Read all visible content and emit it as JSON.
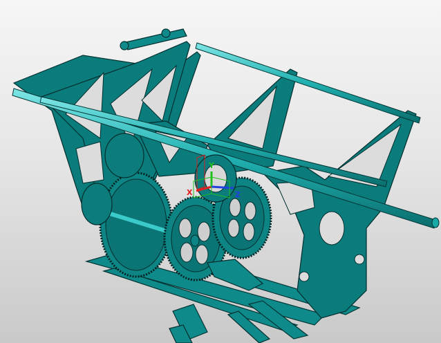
{
  "viewport": {
    "background_top": "#f6f6f6",
    "background_bottom": "#c9c9c9",
    "model_color": "#0d7f7f",
    "model_highlight": "#2ec4c4",
    "edge_color": "#032f2f"
  },
  "triad": {
    "x_label": "X",
    "y_label": "Y",
    "z_label": "Z",
    "x_color": "#e02020",
    "y_color": "#20c020",
    "z_color": "#2040e0"
  },
  "model": {
    "name_icon": "mechanism-assembly-icon"
  }
}
